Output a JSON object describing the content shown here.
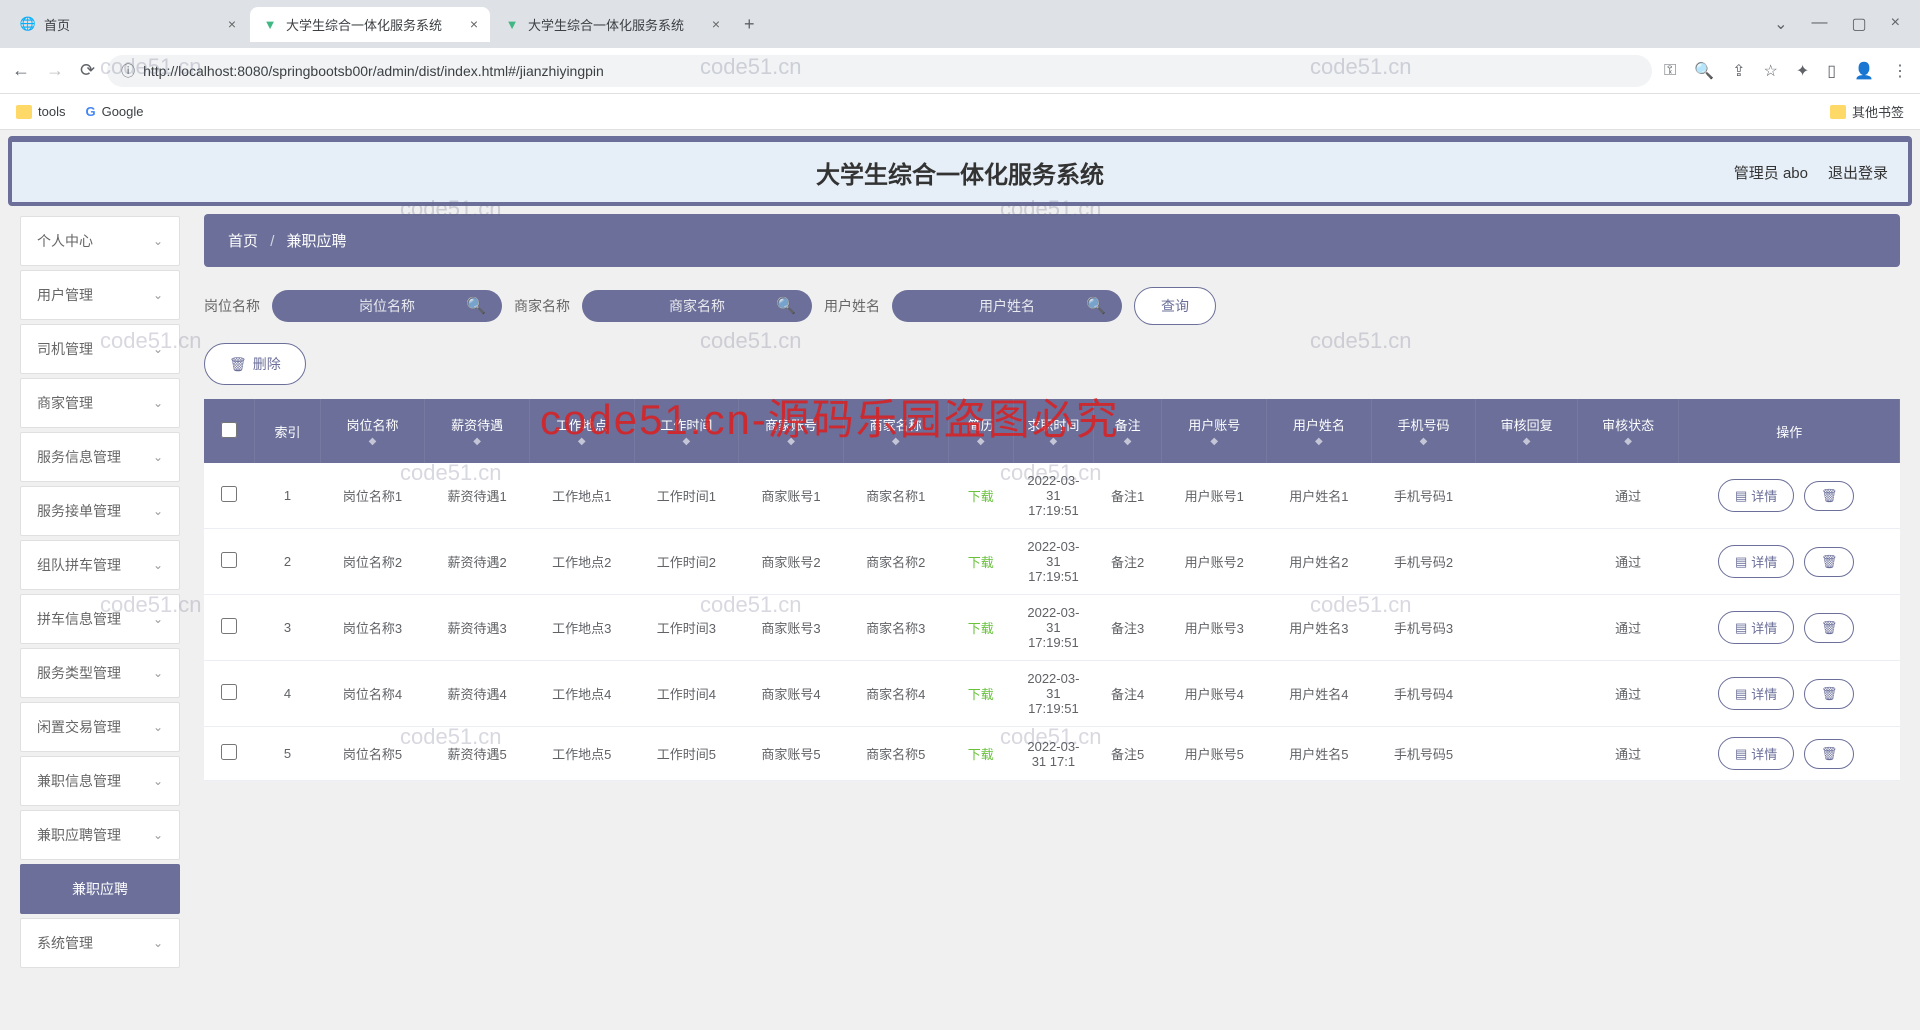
{
  "browser": {
    "tabs": [
      {
        "title": "首页",
        "active": false
      },
      {
        "title": "大学生综合一体化服务系统",
        "active": true
      },
      {
        "title": "大学生综合一体化服务系统",
        "active": false
      }
    ],
    "url": "http://localhost:8080/springbootsb00r/admin/dist/index.html#/jianzhiyingpin",
    "bookmarks": {
      "tools": "tools",
      "google": "Google",
      "other": "其他书签"
    }
  },
  "header": {
    "title": "大学生综合一体化服务系统",
    "admin": "管理员 abo",
    "logout": "退出登录"
  },
  "sidebar": {
    "items": [
      "个人中心",
      "用户管理",
      "司机管理",
      "商家管理",
      "服务信息管理",
      "服务接单管理",
      "组队拼车管理",
      "拼车信息管理",
      "服务类型管理",
      "闲置交易管理",
      "兼职信息管理",
      "兼职应聘管理"
    ],
    "active": "兼职应聘",
    "last": "系统管理"
  },
  "breadcrumb": {
    "home": "首页",
    "current": "兼职应聘"
  },
  "filters": {
    "labels": [
      "岗位名称",
      "商家名称",
      "用户姓名"
    ],
    "placeholders": [
      "岗位名称",
      "商家名称",
      "用户姓名"
    ],
    "query": "查询",
    "delete": "删除"
  },
  "table": {
    "headers": [
      "索引",
      "岗位名称",
      "薪资待遇",
      "工作地点",
      "工作时间",
      "商家账号",
      "商家名称",
      "简历",
      "求职时间",
      "备注",
      "用户账号",
      "用户姓名",
      "手机号码",
      "审核回复",
      "审核状态",
      "操作"
    ],
    "download": "下载",
    "detail": "详情",
    "status_pass": "通过",
    "rows": [
      {
        "idx": 1,
        "post": "岗位名称1",
        "salary": "薪资待遇1",
        "place": "工作地点1",
        "time": "工作时间1",
        "macct": "商家账号1",
        "mname": "商家名称1",
        "apply": "2022-03-31 17:19:51",
        "note": "备注1",
        "uacct": "用户账号1",
        "uname": "用户姓名1",
        "phone": "手机号码1"
      },
      {
        "idx": 2,
        "post": "岗位名称2",
        "salary": "薪资待遇2",
        "place": "工作地点2",
        "time": "工作时间2",
        "macct": "商家账号2",
        "mname": "商家名称2",
        "apply": "2022-03-31 17:19:51",
        "note": "备注2",
        "uacct": "用户账号2",
        "uname": "用户姓名2",
        "phone": "手机号码2"
      },
      {
        "idx": 3,
        "post": "岗位名称3",
        "salary": "薪资待遇3",
        "place": "工作地点3",
        "time": "工作时间3",
        "macct": "商家账号3",
        "mname": "商家名称3",
        "apply": "2022-03-31 17:19:51",
        "note": "备注3",
        "uacct": "用户账号3",
        "uname": "用户姓名3",
        "phone": "手机号码3"
      },
      {
        "idx": 4,
        "post": "岗位名称4",
        "salary": "薪资待遇4",
        "place": "工作地点4",
        "time": "工作时间4",
        "macct": "商家账号4",
        "mname": "商家名称4",
        "apply": "2022-03-31 17:19:51",
        "note": "备注4",
        "uacct": "用户账号4",
        "uname": "用户姓名4",
        "phone": "手机号码4"
      },
      {
        "idx": 5,
        "post": "岗位名称5",
        "salary": "薪资待遇5",
        "place": "工作地点5",
        "time": "工作时间5",
        "macct": "商家账号5",
        "mname": "商家名称5",
        "apply": "2022-03-31 17:1",
        "note": "备注5",
        "uacct": "用户账号5",
        "uname": "用户姓名5",
        "phone": "手机号码5"
      }
    ]
  },
  "watermarks": {
    "small": "code51.cn",
    "big": "code51.cn-源码乐园盗图必究"
  }
}
